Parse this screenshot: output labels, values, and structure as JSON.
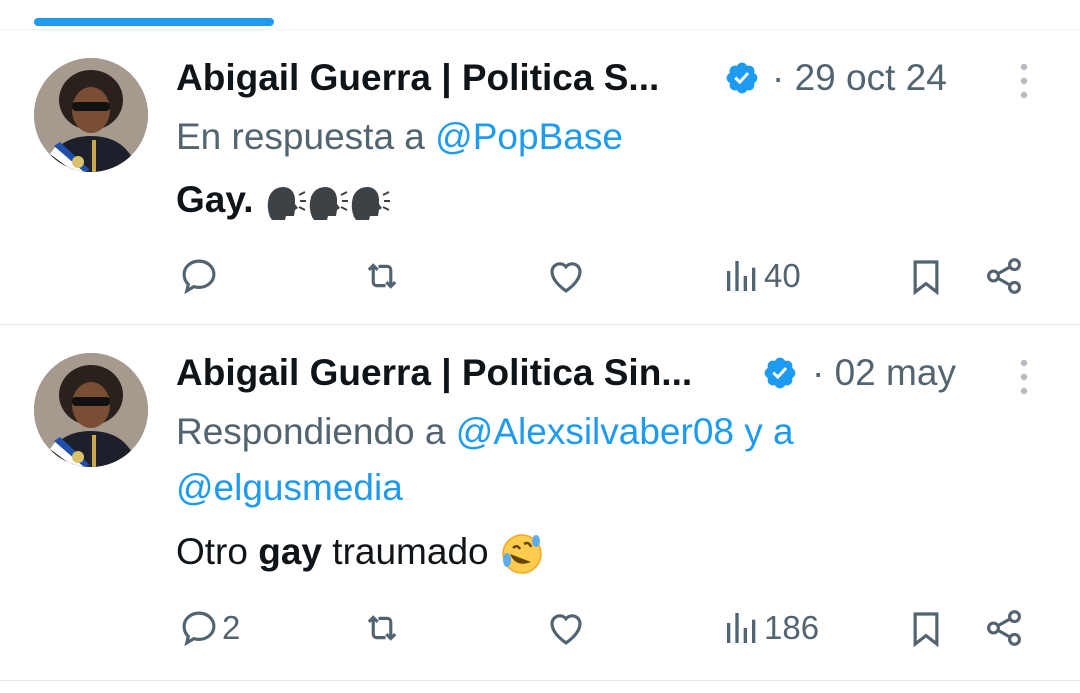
{
  "tweets": [
    {
      "author": "Abigail Guerra | Politica S...",
      "verified": true,
      "separator": "·",
      "time": "29 oct 24",
      "reply_prefix": "En respuesta a ",
      "reply_to": "@PopBase",
      "text_parts": [
        {
          "text": "Gay.",
          "bold": true
        }
      ],
      "emojis": [
        "speaking-head-icon",
        "speaking-head-icon",
        "speaking-head-icon"
      ],
      "replies": "",
      "views": "40"
    },
    {
      "author": "Abigail Guerra | Politica Sin...",
      "verified": true,
      "separator": "·",
      "time": "02 may",
      "reply_prefix": "Respondiendo a ",
      "reply_to_1": "@Alexsilvaber08",
      "reply_joiner": " y a",
      "reply_to_2": "@elgusmedia",
      "text_parts": [
        {
          "text": "Otro ",
          "bold": false
        },
        {
          "text": "gay",
          "bold": true
        },
        {
          "text": " traumado",
          "bold": false
        }
      ],
      "emojis": [
        "rolling-on-floor-laughing-icon"
      ],
      "replies": "2",
      "views": "186"
    }
  ],
  "colors": {
    "accent": "#1d9bf0",
    "secondary_text": "#536471",
    "primary_text": "#0f1419",
    "divider": "#eff3f4"
  }
}
